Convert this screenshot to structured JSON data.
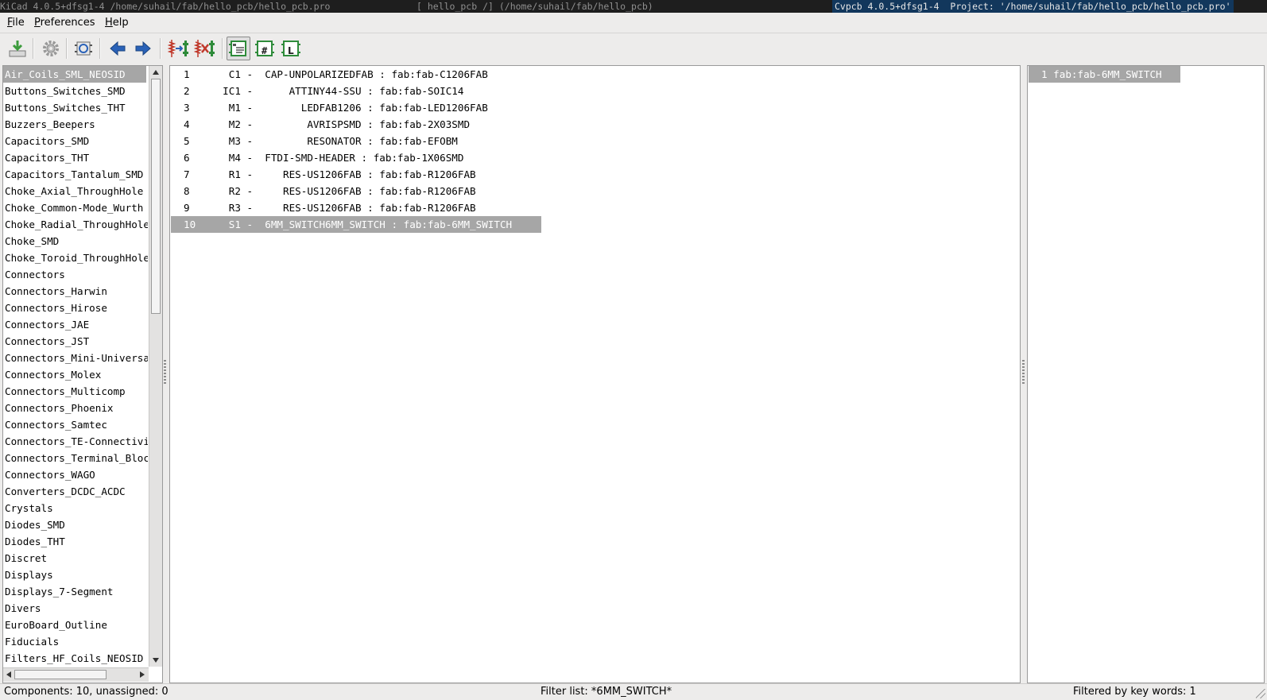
{
  "titlebar": {
    "kicad_window": "KiCad 4.0.5+dfsg1-4 /home/suhail/fab/hello_pcb/hello_pcb.pro",
    "eeschema_window": "[ hello_pcb /] (/home/suhail/fab/hello_pcb)",
    "active_window": "Cvpcb 4.0.5+dfsg1-4  Project: '/home/suhail/fab/hello_pcb/hello_pcb.pro'"
  },
  "menu": {
    "file": {
      "mnemonic": "F",
      "rest": "ile"
    },
    "preferences": {
      "mnemonic": "P",
      "rest": "references"
    },
    "help": {
      "mnemonic": "H",
      "rest": "elp"
    }
  },
  "toolbar": {
    "icons": [
      "save-icon",
      "settings-icon",
      "view-footprint-icon",
      "previous-icon",
      "next-icon",
      "auto-associate-icon",
      "delete-associations-icon",
      "filter-keywords-icon",
      "filter-pin-count-icon",
      "filter-library-icon"
    ],
    "colors": {
      "blue_arrow": "#2a62b8",
      "red": "#c0392b",
      "green": "#2e8b3a"
    }
  },
  "libraries": [
    "Air_Coils_SML_NEOSID",
    "Buttons_Switches_SMD",
    "Buttons_Switches_THT",
    "Buzzers_Beepers",
    "Capacitors_SMD",
    "Capacitors_THT",
    "Capacitors_Tantalum_SMD",
    "Choke_Axial_ThroughHole",
    "Choke_Common-Mode_Wurth",
    "Choke_Radial_ThroughHole",
    "Choke_SMD",
    "Choke_Toroid_ThroughHole",
    "Connectors",
    "Connectors_Harwin",
    "Connectors_Hirose",
    "Connectors_JAE",
    "Connectors_JST",
    "Connectors_Mini-Universal",
    "Connectors_Molex",
    "Connectors_Multicomp",
    "Connectors_Phoenix",
    "Connectors_Samtec",
    "Connectors_TE-Connectivity",
    "Connectors_Terminal_Blocks",
    "Connectors_WAGO",
    "Converters_DCDC_ACDC",
    "Crystals",
    "Diodes_SMD",
    "Diodes_THT",
    "Discret",
    "Displays",
    "Displays_7-Segment",
    "Divers",
    "EuroBoard_Outline",
    "Fiducials",
    "Filters_HF_Coils_NEOSID"
  ],
  "components": [
    {
      "index": "1",
      "text": "   C1 -  CAP-UNPOLARIZEDFAB : fab:fab-C1206FAB"
    },
    {
      "index": "2",
      "text": "  IC1 -      ATTINY44-SSU : fab:fab-SOIC14"
    },
    {
      "index": "3",
      "text": "   M1 -        LEDFAB1206 : fab:fab-LED1206FAB"
    },
    {
      "index": "4",
      "text": "   M2 -         AVRISPSMD : fab:fab-2X03SMD"
    },
    {
      "index": "5",
      "text": "   M3 -         RESONATOR : fab:fab-EFOBM"
    },
    {
      "index": "6",
      "text": "   M4 -  FTDI-SMD-HEADER : fab:fab-1X06SMD"
    },
    {
      "index": "7",
      "text": "   R1 -     RES-US1206FAB : fab:fab-R1206FAB"
    },
    {
      "index": "8",
      "text": "   R2 -     RES-US1206FAB : fab:fab-R1206FAB"
    },
    {
      "index": "9",
      "text": "   R3 -     RES-US1206FAB : fab:fab-R1206FAB"
    },
    {
      "index": "10",
      "text": "   S1 -  6MM_SWITCH6MM_SWITCH : fab:fab-6MM_SWITCH"
    }
  ],
  "footprints": [
    "1 fab:fab-6MM_SWITCH"
  ],
  "status": {
    "components": "Components: 10, unassigned: 0",
    "filter_list": "Filter list: *6MM_SWITCH*",
    "filtered_by": "Filtered by key words: 1"
  },
  "selection": {
    "library_index": 0,
    "component_index": 9,
    "footprint_index": 0
  },
  "colors": {
    "selection": "#a6a6a6",
    "active_title": "#12375c"
  }
}
